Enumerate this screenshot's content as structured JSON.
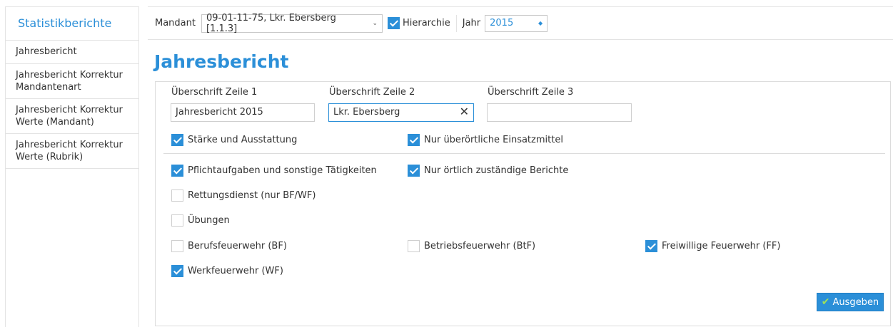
{
  "sidebar": {
    "title": "Statistikberichte",
    "items": [
      {
        "label": "Jahresbericht"
      },
      {
        "label": "Jahresbericht Korrektur Mandantenart"
      },
      {
        "label": "Jahresbericht Korrektur Werte (Mandant)"
      },
      {
        "label": "Jahresbericht Korrektur Werte (Rubrik)"
      }
    ]
  },
  "toolbar": {
    "mandant_label": "Mandant",
    "mandant_value": "09-01-11-75, Lkr. Ebersberg [1.1.3]",
    "hierarchie_label": "Hierarchie",
    "hierarchie_checked": true,
    "jahr_label": "Jahr",
    "jahr_value": "2015"
  },
  "page": {
    "title": "Jahresbericht"
  },
  "form": {
    "headline1_label": "Überschrift Zeile 1",
    "headline1_value": "Jahresbericht 2015",
    "headline2_label": "Überschrift Zeile 2",
    "headline2_value": "Lkr. Ebersberg",
    "headline3_label": "Überschrift Zeile 3",
    "headline3_value": "",
    "checks": {
      "staerke": {
        "label": "Stärke und Ausstattung",
        "checked": true
      },
      "ueberoertlich": {
        "label": "Nur überörtliche Einsatzmittel",
        "checked": true
      },
      "pflicht": {
        "label": "Pflichtaufgaben und sonstige Tätigkeiten",
        "checked": true
      },
      "oertlich": {
        "label": "Nur örtlich zuständige Berichte",
        "checked": true
      },
      "rettung": {
        "label": "Rettungsdienst (nur BF/WF)",
        "checked": false
      },
      "uebungen": {
        "label": "Übungen",
        "checked": false
      },
      "bf": {
        "label": "Berufsfeuerwehr (BF)",
        "checked": false
      },
      "btf": {
        "label": "Betriebsfeuerwehr (BtF)",
        "checked": false
      },
      "ff": {
        "label": "Freiwillige Feuerwehr (FF)",
        "checked": true
      },
      "wf": {
        "label": "Werkfeuerwehr (WF)",
        "checked": true
      }
    },
    "submit_label": "Ausgeben"
  },
  "colors": {
    "accent": "#2b8fd8",
    "check_green": "#9fe05a"
  }
}
